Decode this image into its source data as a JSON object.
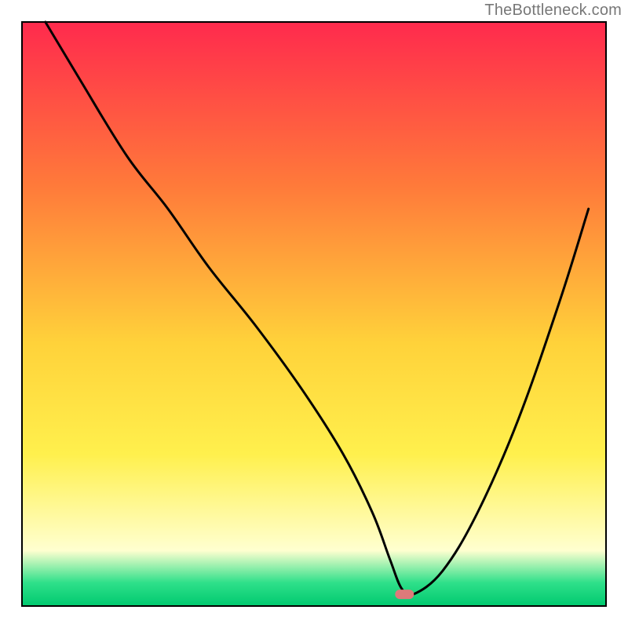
{
  "watermark": "TheBottleneck.com",
  "chart_data": {
    "type": "line",
    "title": "",
    "xlabel": "",
    "ylabel": "",
    "xlim": [
      0,
      100
    ],
    "ylim": [
      0,
      100
    ],
    "grid": false,
    "legend": false,
    "marker": {
      "x": 65.5,
      "y": 2,
      "color": "#dd7a7a"
    },
    "series": [
      {
        "name": "curve",
        "color": "#000000",
        "x": [
          4,
          10,
          18,
          25,
          32,
          40,
          48,
          55,
          60,
          63,
          65,
          67,
          72,
          78,
          85,
          92,
          97
        ],
        "y": [
          100,
          90,
          77,
          68,
          58,
          48,
          37,
          26,
          16,
          8,
          3,
          2,
          6,
          16,
          32,
          52,
          68
        ]
      }
    ],
    "background_gradient": {
      "top_color": "#ff2a4d",
      "mid_upper_color": "#ff7a3a",
      "mid_color": "#ffd23a",
      "mid_lower_color": "#fff04d",
      "pale_color": "#ffffd0",
      "green_color": "#2fe08a",
      "bottom_color": "#00c96f"
    }
  }
}
